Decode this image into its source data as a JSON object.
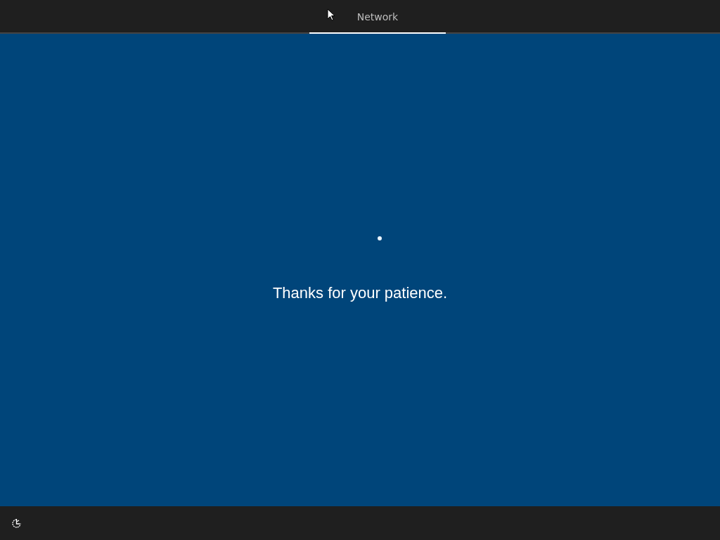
{
  "header": {
    "tabs": [
      {
        "label": "Network",
        "selected": true
      }
    ]
  },
  "main": {
    "message": "Thanks for your patience."
  }
}
